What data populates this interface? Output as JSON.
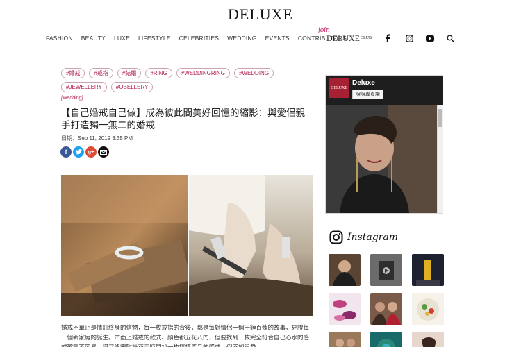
{
  "header": {
    "logo": "DELUXE",
    "nav": [
      "FASHION",
      "BEAUTY",
      "LUXE",
      "LIFESTYLE",
      "CELEBRITIES",
      "WEDDING",
      "EVENTS",
      "CONTRIBUTORS"
    ],
    "club": {
      "join": "join",
      "brand": "DELUXE",
      "suffix": "CLUB"
    },
    "social_icons": [
      "facebook-icon",
      "instagram-icon",
      "youtube-icon",
      "search-icon"
    ]
  },
  "article": {
    "tags": [
      "#婚戒",
      "#戒指",
      "#結婚",
      "#RING",
      "#WEDDINGRING",
      "#WEDDING",
      "#JEWELLERY",
      "#OBELLERY"
    ],
    "category": "[Wedding]",
    "title": "【自己婚戒自己做】成為彼此間美好回憶的縮影：與愛侶親手打造獨一無二的婚戒",
    "date": "日期：Sep 11, 2019 3:35 PM",
    "share_icons": [
      "facebook-share-icon",
      "twitter-share-icon",
      "google-plus-share-icon",
      "email-share-icon"
    ],
    "body": "婚戒不單止是情訂終身的信物，每一枚戒指的背後，都是每對情侶一個千錘百煉的故事，見證每一個新家庭的誕生。市面上婚戒的款式、顏色都五花八門，但要找到一枚完全符合自己心水的感戒確實不容易。與其終審附計花走時間找一枚搞搞產品的感戒，倒不如與愛"
  },
  "sidebar": {
    "facebook": {
      "page_name": "Deluxe",
      "like_label": "說說專頁讚",
      "logo_text": "DELUXE"
    },
    "instagram": {
      "title": "Instagram"
    }
  },
  "colors": {
    "accent": "#b11c4e",
    "fb_blue": "#3b5998",
    "twitter": "#1da1f2",
    "gplus": "#dd4b39"
  }
}
